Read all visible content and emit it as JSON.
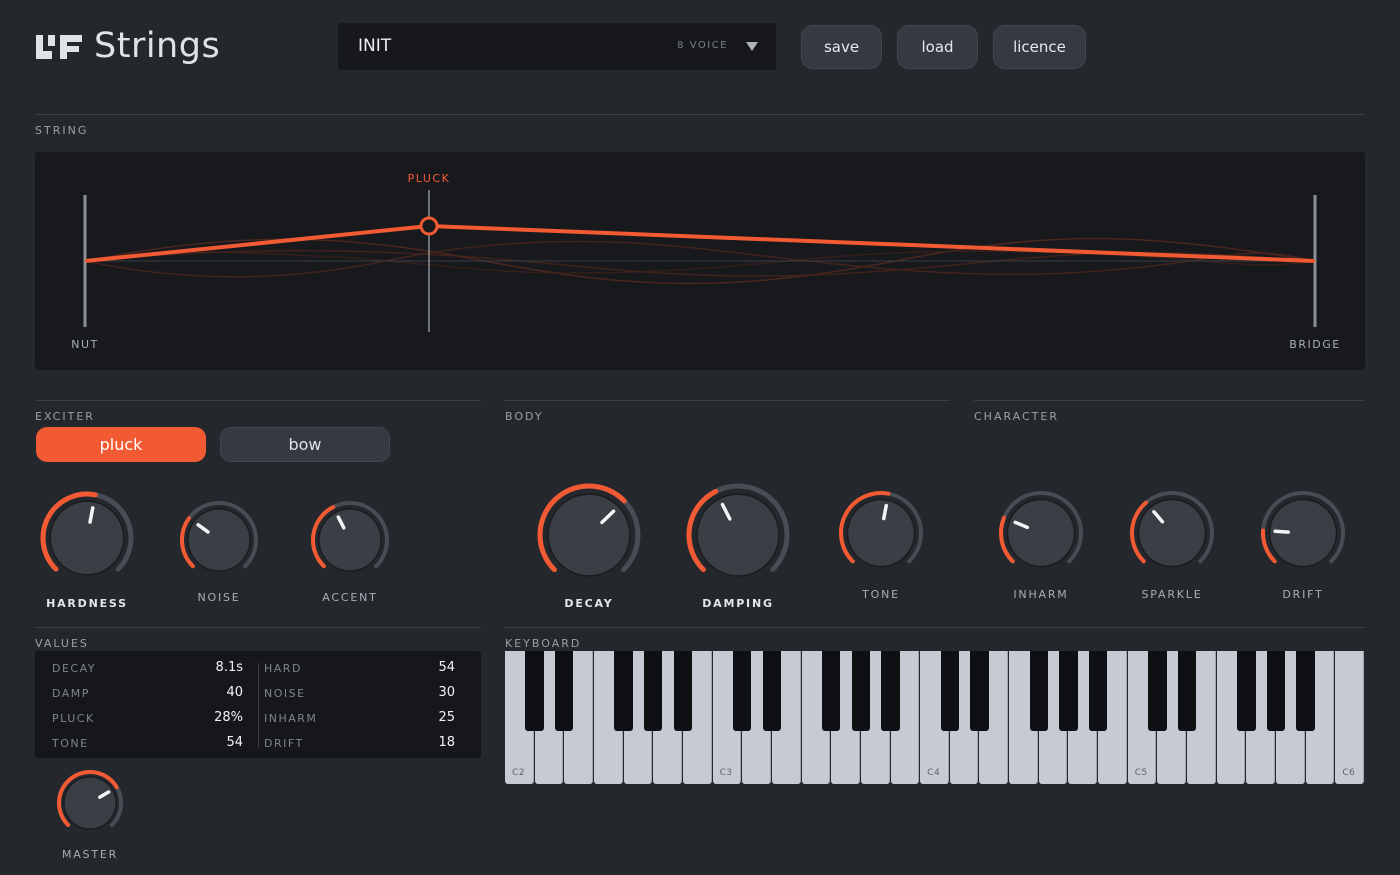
{
  "header": {
    "app_title": "Strings",
    "preset_name": "INIT",
    "voice_label": "8 VOICE",
    "save_label": "save",
    "load_label": "load",
    "licence_label": "licence"
  },
  "string": {
    "section_label": "STRING",
    "pluck_label": "PLUCK",
    "nut_label": "NUT",
    "bridge_label": "BRIDGE",
    "pluck_position": 0.28
  },
  "exciter": {
    "section_label": "EXCITER",
    "modes": [
      "pluck",
      "bow"
    ],
    "active_mode": "pluck",
    "knobs": [
      {
        "label": "HARDNESS",
        "value": 0.54,
        "big": true
      },
      {
        "label": "NOISE",
        "value": 0.3,
        "big": false
      },
      {
        "label": "ACCENT",
        "value": 0.4,
        "big": false
      }
    ]
  },
  "body": {
    "section_label": "BODY",
    "knobs": [
      {
        "label": "DECAY",
        "value": 0.67,
        "big": true
      },
      {
        "label": "DAMPING",
        "value": 0.4,
        "big": true
      },
      {
        "label": "TONE",
        "value": 0.54,
        "big": false
      }
    ]
  },
  "character": {
    "section_label": "CHARACTER",
    "knobs": [
      {
        "label": "INHARM",
        "value": 0.25,
        "big": false
      },
      {
        "label": "SPARKLE",
        "value": 0.35,
        "big": false
      },
      {
        "label": "DRIFT",
        "value": 0.18,
        "big": false
      }
    ]
  },
  "values": {
    "section_label": "VALUES",
    "left": [
      {
        "key": "DECAY",
        "val": "8.1s"
      },
      {
        "key": "DAMP",
        "val": "40"
      },
      {
        "key": "PLUCK",
        "val": "28%"
      },
      {
        "key": "TONE",
        "val": "54"
      }
    ],
    "right": [
      {
        "key": "HARD",
        "val": "54"
      },
      {
        "key": "NOISE",
        "val": "30"
      },
      {
        "key": "INHARM",
        "val": "25"
      },
      {
        "key": "DRIFT",
        "val": "18"
      }
    ]
  },
  "master": {
    "label": "MASTER",
    "value": 0.72
  },
  "keyboard": {
    "section_label": "KEYBOARD",
    "octave_labels": [
      "C2",
      "C3",
      "C4",
      "C5",
      "C6"
    ]
  },
  "colors": {
    "accent": "#f25a33",
    "background": "#24272c",
    "panel": "#17191d",
    "knob_track": "#484c55"
  }
}
